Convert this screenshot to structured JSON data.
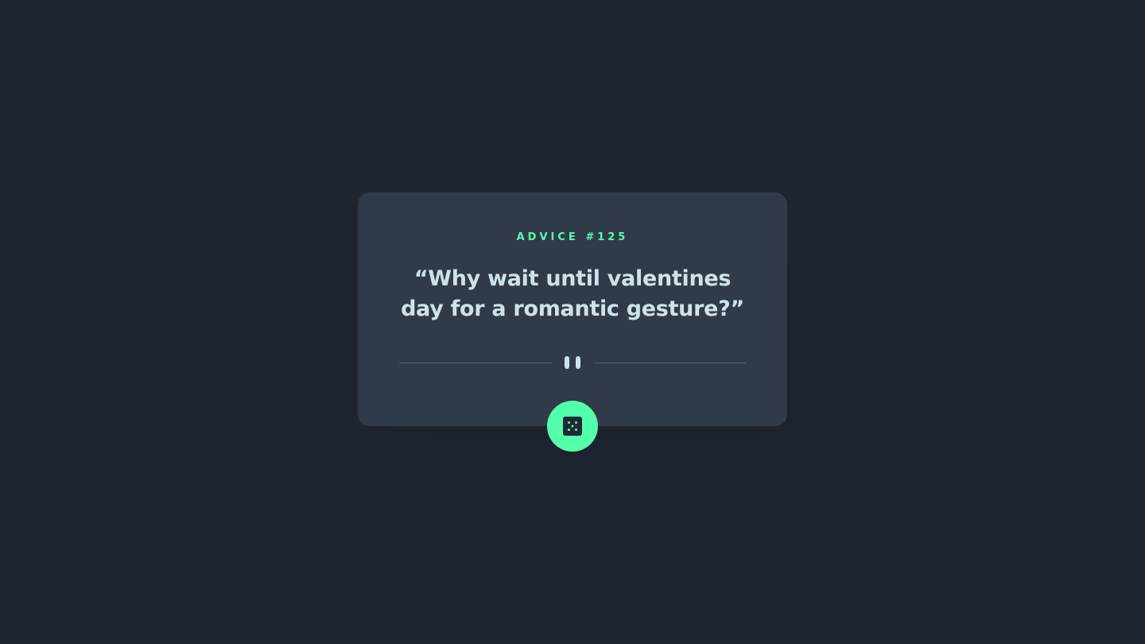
{
  "card": {
    "advice_label": "ADVICE #125",
    "quote": "“Why wait until valentines day for a romantic gesture?”"
  },
  "icons": {
    "divider": "pause-icon",
    "button": "dice-icon"
  },
  "colors": {
    "background": "#1f2632",
    "card": "#313a48",
    "accent": "#53ffaa",
    "text": "#cee3e9",
    "divider": "#4f5d74"
  }
}
